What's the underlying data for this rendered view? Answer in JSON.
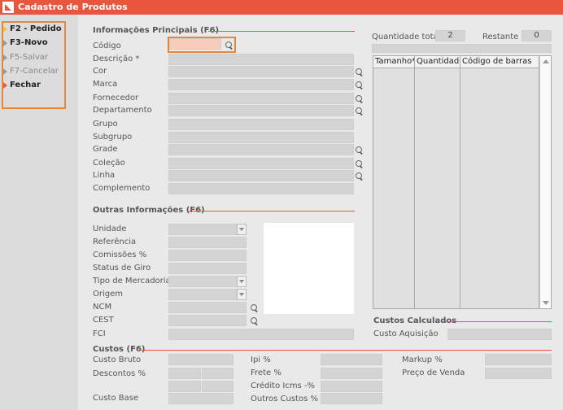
{
  "window": {
    "title": "Cadastro de Produtos"
  },
  "sidebar": {
    "items": [
      {
        "label": "F2 - Pedido"
      },
      {
        "label": "F3-Novo"
      },
      {
        "label": "F5-Salvar"
      },
      {
        "label": "F7-Cancelar"
      },
      {
        "label": "Fechar"
      }
    ]
  },
  "main_info": {
    "title": "Informações Principais (F6)",
    "codigo": "Código",
    "descricao": "Descrição *",
    "cor": "Cor",
    "marca": "Marca",
    "fornecedor": "Fornecedor",
    "departamento": "Departamento",
    "grupo": "Grupo",
    "subgrupo": "Subgrupo",
    "grade": "Grade",
    "colecao": "Coleção",
    "linha": "Linha",
    "complemento": "Complemento"
  },
  "other_info": {
    "title": "Outras Informações (F6)",
    "unidade": "Unidade",
    "referencia": "Referência",
    "comissoes": "Comissões %",
    "status_giro": "Status de Giro",
    "tipo_mercadoria": "Tipo de Mercadoria",
    "origem": "Origem",
    "ncm": "NCM",
    "cest": "CEST",
    "fci": "FCI"
  },
  "quantity": {
    "total_label": "Quantidade total",
    "total_value": "2",
    "remaining_label": "Restante",
    "remaining_value": "0"
  },
  "grid": {
    "columns": [
      "Tamanho*",
      "Quantidade",
      "Código de barras"
    ]
  },
  "calc_costs": {
    "title": "Custos Calculados",
    "acquisition": "Custo Aquisição"
  },
  "costs": {
    "title": "Custos (F6)",
    "custo_bruto": "Custo Bruto",
    "descontos": "Descontos %",
    "custo_base": "Custo Base",
    "ipi": "Ipi %",
    "frete": "Frete %",
    "credito_icms": "Crédito Icms -%",
    "outros_custos": "Outros Custos %",
    "markup": "Markup %",
    "preco_venda": "Preço de Venda"
  },
  "colors": {
    "accent": "#e8563e",
    "highlight": "#e8873b"
  }
}
